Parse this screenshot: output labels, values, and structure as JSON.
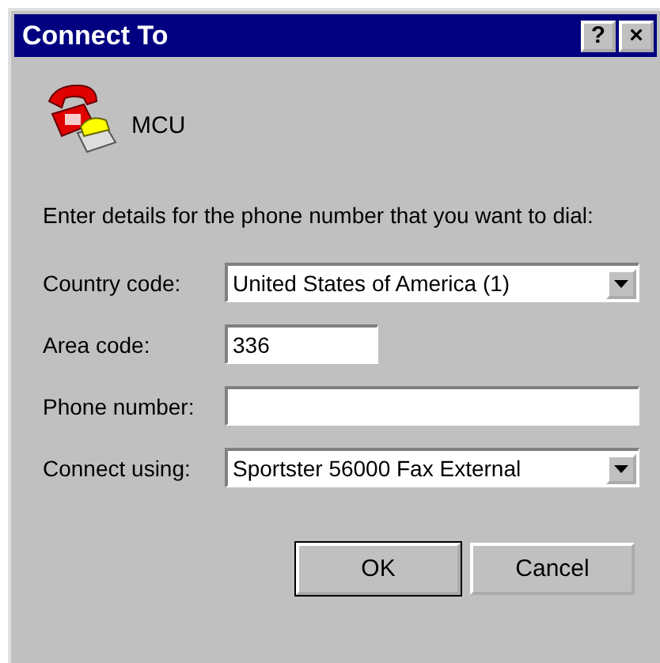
{
  "window": {
    "title": "Connect To",
    "title_buttons": [
      "?",
      "×"
    ]
  },
  "connection": {
    "name": "MCU"
  },
  "instruction": "Enter details for the phone number that you want to dial:",
  "fields": [
    {
      "kind": "dropdown",
      "label": "Country code:",
      "value": "United States of America (1)"
    },
    {
      "kind": "short",
      "label": "Area code:",
      "value": "336"
    },
    {
      "kind": "text",
      "label": "Phone number:"
    },
    {
      "kind": "dropdown",
      "label": "Connect using:",
      "value": "Sportster 56000 Fax External"
    }
  ],
  "buttons": [
    {
      "label": "OK",
      "default": true
    },
    {
      "label": "Cancel",
      "default": false
    }
  ]
}
